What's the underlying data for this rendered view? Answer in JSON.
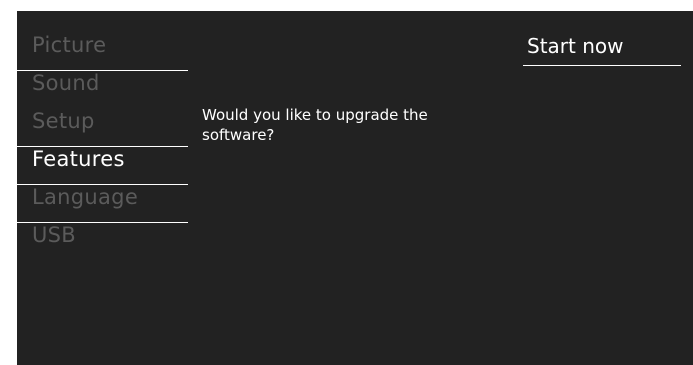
{
  "menu": {
    "items": [
      {
        "label": "Picture"
      },
      {
        "label": "Sound"
      },
      {
        "label": "Setup"
      },
      {
        "label": "Features"
      },
      {
        "label": "Language"
      },
      {
        "label": "USB"
      }
    ],
    "selected": "Features"
  },
  "dialog": {
    "prompt": "Would you like to upgrade the software?"
  },
  "actions": {
    "start_label": "Start now"
  },
  "colors": {
    "background": "#222222",
    "text_active": "#ffffff",
    "text_inactive": "#5b5b5b",
    "divider": "#ffffff"
  }
}
